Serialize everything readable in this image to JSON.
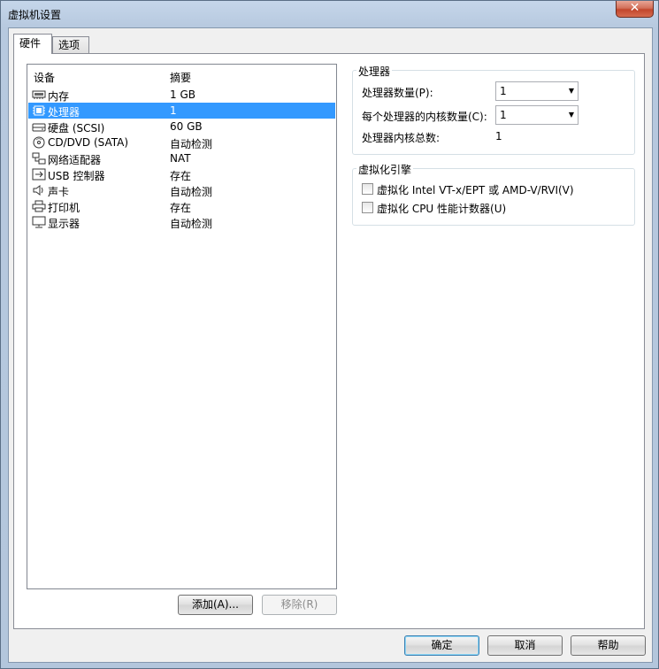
{
  "window": {
    "title": "虚拟机设置",
    "close_label": "✕"
  },
  "tabs": [
    {
      "label": "硬件",
      "active": true
    },
    {
      "label": "选项",
      "active": false
    }
  ],
  "device_list": {
    "col_device": "设备",
    "col_summary": "摘要",
    "rows": [
      {
        "name": "内存",
        "summary": "1 GB",
        "icon": "memory-icon"
      },
      {
        "name": "处理器",
        "summary": "1",
        "icon": "processor-icon",
        "selected": true
      },
      {
        "name": "硬盘 (SCSI)",
        "summary": "60 GB",
        "icon": "hard-disk-icon"
      },
      {
        "name": "CD/DVD (SATA)",
        "summary": "自动检测",
        "icon": "cd-dvd-icon"
      },
      {
        "name": "网络适配器",
        "summary": "NAT",
        "icon": "network-adapter-icon"
      },
      {
        "name": "USB 控制器",
        "summary": "存在",
        "icon": "usb-icon"
      },
      {
        "name": "声卡",
        "summary": "自动检测",
        "icon": "speaker-icon"
      },
      {
        "name": "打印机",
        "summary": "存在",
        "icon": "printer-icon"
      },
      {
        "name": "显示器",
        "summary": "自动检测",
        "icon": "monitor-icon"
      }
    ],
    "add_label": "添加(A)...",
    "remove_label": "移除(R)"
  },
  "processors": {
    "group_title": "处理器",
    "count_label": "处理器数量(P):",
    "count_value": "1",
    "cores_label": "每个处理器的内核数量(C):",
    "cores_value": "1",
    "total_label": "处理器内核总数:",
    "total_value": "1"
  },
  "virtualization": {
    "group_title": "虚拟化引擎",
    "vtx_label": "虚拟化 Intel VT-x/EPT 或 AMD-V/RVI(V)",
    "perf_label": "虚拟化 CPU 性能计数器(U)"
  },
  "footer": {
    "ok_label": "确定",
    "cancel_label": "取消",
    "help_label": "帮助"
  }
}
